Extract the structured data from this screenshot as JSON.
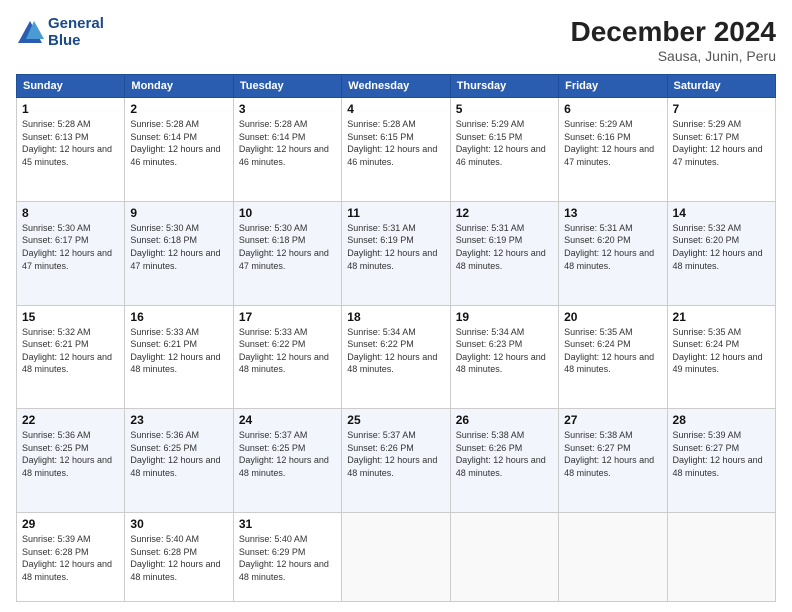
{
  "header": {
    "logo_line1": "General",
    "logo_line2": "Blue",
    "title": "December 2024",
    "subtitle": "Sausa, Junin, Peru"
  },
  "days_of_week": [
    "Sunday",
    "Monday",
    "Tuesday",
    "Wednesday",
    "Thursday",
    "Friday",
    "Saturday"
  ],
  "weeks": [
    [
      {
        "day": 1,
        "sunrise": "5:28 AM",
        "sunset": "6:13 PM",
        "daylight": "12 hours and 45 minutes."
      },
      {
        "day": 2,
        "sunrise": "5:28 AM",
        "sunset": "6:14 PM",
        "daylight": "12 hours and 46 minutes."
      },
      {
        "day": 3,
        "sunrise": "5:28 AM",
        "sunset": "6:14 PM",
        "daylight": "12 hours and 46 minutes."
      },
      {
        "day": 4,
        "sunrise": "5:28 AM",
        "sunset": "6:15 PM",
        "daylight": "12 hours and 46 minutes."
      },
      {
        "day": 5,
        "sunrise": "5:29 AM",
        "sunset": "6:15 PM",
        "daylight": "12 hours and 46 minutes."
      },
      {
        "day": 6,
        "sunrise": "5:29 AM",
        "sunset": "6:16 PM",
        "daylight": "12 hours and 47 minutes."
      },
      {
        "day": 7,
        "sunrise": "5:29 AM",
        "sunset": "6:17 PM",
        "daylight": "12 hours and 47 minutes."
      }
    ],
    [
      {
        "day": 8,
        "sunrise": "5:30 AM",
        "sunset": "6:17 PM",
        "daylight": "12 hours and 47 minutes."
      },
      {
        "day": 9,
        "sunrise": "5:30 AM",
        "sunset": "6:18 PM",
        "daylight": "12 hours and 47 minutes."
      },
      {
        "day": 10,
        "sunrise": "5:30 AM",
        "sunset": "6:18 PM",
        "daylight": "12 hours and 47 minutes."
      },
      {
        "day": 11,
        "sunrise": "5:31 AM",
        "sunset": "6:19 PM",
        "daylight": "12 hours and 48 minutes."
      },
      {
        "day": 12,
        "sunrise": "5:31 AM",
        "sunset": "6:19 PM",
        "daylight": "12 hours and 48 minutes."
      },
      {
        "day": 13,
        "sunrise": "5:31 AM",
        "sunset": "6:20 PM",
        "daylight": "12 hours and 48 minutes."
      },
      {
        "day": 14,
        "sunrise": "5:32 AM",
        "sunset": "6:20 PM",
        "daylight": "12 hours and 48 minutes."
      }
    ],
    [
      {
        "day": 15,
        "sunrise": "5:32 AM",
        "sunset": "6:21 PM",
        "daylight": "12 hours and 48 minutes."
      },
      {
        "day": 16,
        "sunrise": "5:33 AM",
        "sunset": "6:21 PM",
        "daylight": "12 hours and 48 minutes."
      },
      {
        "day": 17,
        "sunrise": "5:33 AM",
        "sunset": "6:22 PM",
        "daylight": "12 hours and 48 minutes."
      },
      {
        "day": 18,
        "sunrise": "5:34 AM",
        "sunset": "6:22 PM",
        "daylight": "12 hours and 48 minutes."
      },
      {
        "day": 19,
        "sunrise": "5:34 AM",
        "sunset": "6:23 PM",
        "daylight": "12 hours and 48 minutes."
      },
      {
        "day": 20,
        "sunrise": "5:35 AM",
        "sunset": "6:24 PM",
        "daylight": "12 hours and 48 minutes."
      },
      {
        "day": 21,
        "sunrise": "5:35 AM",
        "sunset": "6:24 PM",
        "daylight": "12 hours and 49 minutes."
      }
    ],
    [
      {
        "day": 22,
        "sunrise": "5:36 AM",
        "sunset": "6:25 PM",
        "daylight": "12 hours and 48 minutes."
      },
      {
        "day": 23,
        "sunrise": "5:36 AM",
        "sunset": "6:25 PM",
        "daylight": "12 hours and 48 minutes."
      },
      {
        "day": 24,
        "sunrise": "5:37 AM",
        "sunset": "6:25 PM",
        "daylight": "12 hours and 48 minutes."
      },
      {
        "day": 25,
        "sunrise": "5:37 AM",
        "sunset": "6:26 PM",
        "daylight": "12 hours and 48 minutes."
      },
      {
        "day": 26,
        "sunrise": "5:38 AM",
        "sunset": "6:26 PM",
        "daylight": "12 hours and 48 minutes."
      },
      {
        "day": 27,
        "sunrise": "5:38 AM",
        "sunset": "6:27 PM",
        "daylight": "12 hours and 48 minutes."
      },
      {
        "day": 28,
        "sunrise": "5:39 AM",
        "sunset": "6:27 PM",
        "daylight": "12 hours and 48 minutes."
      }
    ],
    [
      {
        "day": 29,
        "sunrise": "5:39 AM",
        "sunset": "6:28 PM",
        "daylight": "12 hours and 48 minutes."
      },
      {
        "day": 30,
        "sunrise": "5:40 AM",
        "sunset": "6:28 PM",
        "daylight": "12 hours and 48 minutes."
      },
      {
        "day": 31,
        "sunrise": "5:40 AM",
        "sunset": "6:29 PM",
        "daylight": "12 hours and 48 minutes."
      },
      null,
      null,
      null,
      null
    ]
  ]
}
